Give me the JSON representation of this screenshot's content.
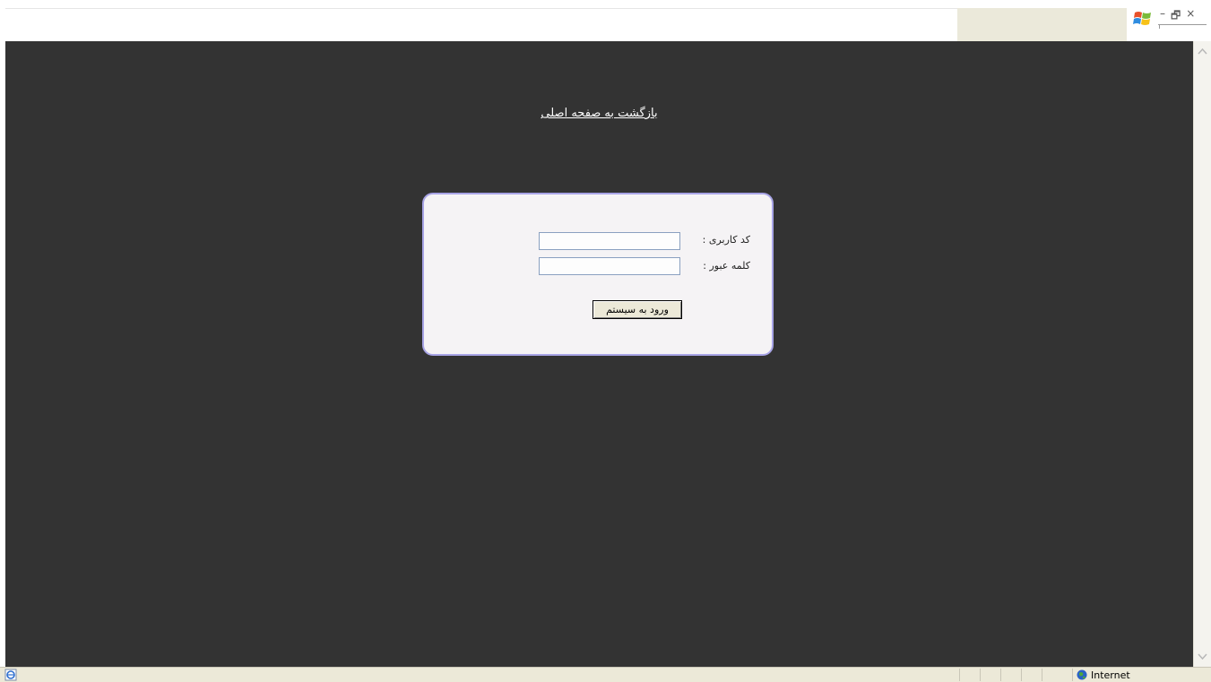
{
  "page": {
    "back_link": "بازگشت به صفحه اصلی"
  },
  "login": {
    "username_label": "کد کاربری :",
    "password_label": "کلمه عبور :",
    "username_value": "",
    "password_value": "",
    "submit_label": "ورود به سیستم"
  },
  "window": {
    "minimize": "–",
    "restore": "🗗",
    "close": "×"
  },
  "statusbar": {
    "zone": "Internet"
  },
  "colors": {
    "page_background": "#333333",
    "login_box_background": "#f5f3f5",
    "login_box_border": "#a8a4e6",
    "link_color": "#ffffff"
  },
  "icons": [
    "windows-logo-icon",
    "ie-page-icon",
    "globe-icon",
    "scroll-up-icon",
    "scroll-down-icon"
  ]
}
